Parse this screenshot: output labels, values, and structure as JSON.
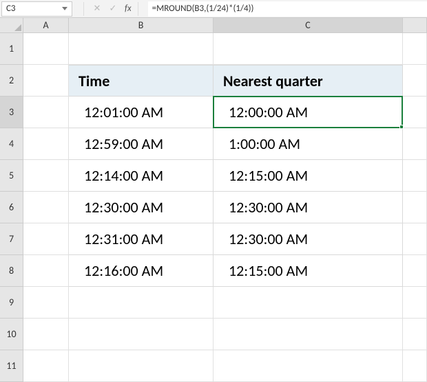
{
  "formula_bar": {
    "cell_ref": "C3",
    "cancel_icon": "✕",
    "confirm_icon": "✓",
    "fx_label": "fx",
    "formula": "=MROUND(B3,(1/24)*(1/4))"
  },
  "columns": [
    "A",
    "B",
    "C"
  ],
  "rows": [
    "1",
    "2",
    "3",
    "4",
    "5",
    "6",
    "7",
    "8",
    "9",
    "10",
    "11"
  ],
  "selected_cell": "C3",
  "table": {
    "header": {
      "time": "Time",
      "quarter": "Nearest quarter"
    },
    "rows": [
      {
        "time": "12:01:00 AM",
        "quarter": "12:00:00 AM"
      },
      {
        "time": "12:59:00 AM",
        "quarter": "1:00:00 AM"
      },
      {
        "time": "12:14:00 AM",
        "quarter": "12:15:00 AM"
      },
      {
        "time": "12:30:00 AM",
        "quarter": "12:30:00 AM"
      },
      {
        "time": "12:31:00 AM",
        "quarter": "12:30:00 AM"
      },
      {
        "time": "12:16:00 AM",
        "quarter": "12:15:00 AM"
      }
    ]
  }
}
